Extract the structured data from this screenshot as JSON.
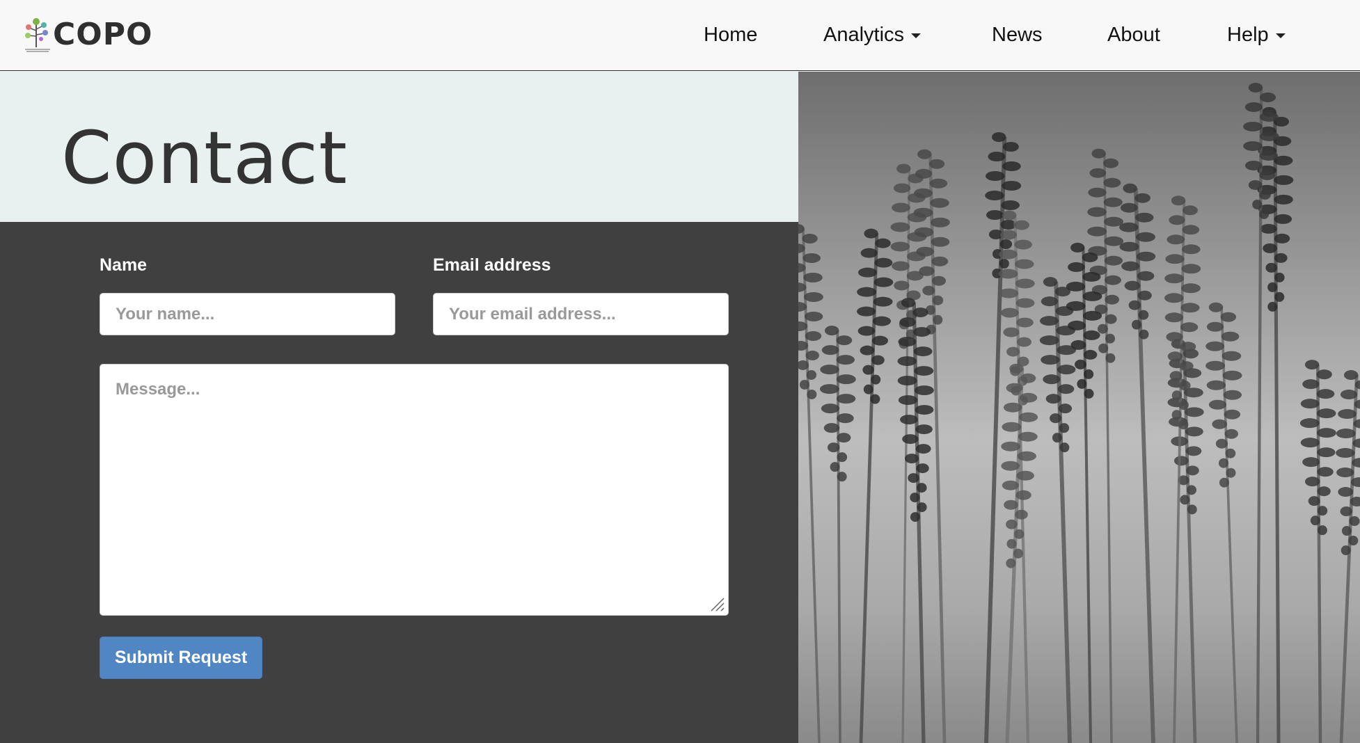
{
  "brand": {
    "name": "COPO",
    "logo_icon": "tree-logo-icon"
  },
  "nav": {
    "items": [
      {
        "label": "Home",
        "dropdown": false
      },
      {
        "label": "Analytics",
        "dropdown": true
      },
      {
        "label": "News",
        "dropdown": false
      },
      {
        "label": "About",
        "dropdown": false
      },
      {
        "label": "Help",
        "dropdown": true
      }
    ]
  },
  "page": {
    "title": "Contact"
  },
  "form": {
    "name_label": "Name",
    "name_placeholder": "Your name...",
    "name_value": "",
    "email_label": "Email address",
    "email_placeholder": "Your email address...",
    "email_value": "",
    "message_placeholder": "Message...",
    "message_value": "",
    "submit_label": "Submit Request"
  },
  "colors": {
    "navbar_bg": "#f8f8f8",
    "hero_bg": "#e9f0f0",
    "form_bg": "#404040",
    "submit_bg": "#5086c4"
  },
  "image": {
    "subject": "lavender-photo-grayscale"
  }
}
